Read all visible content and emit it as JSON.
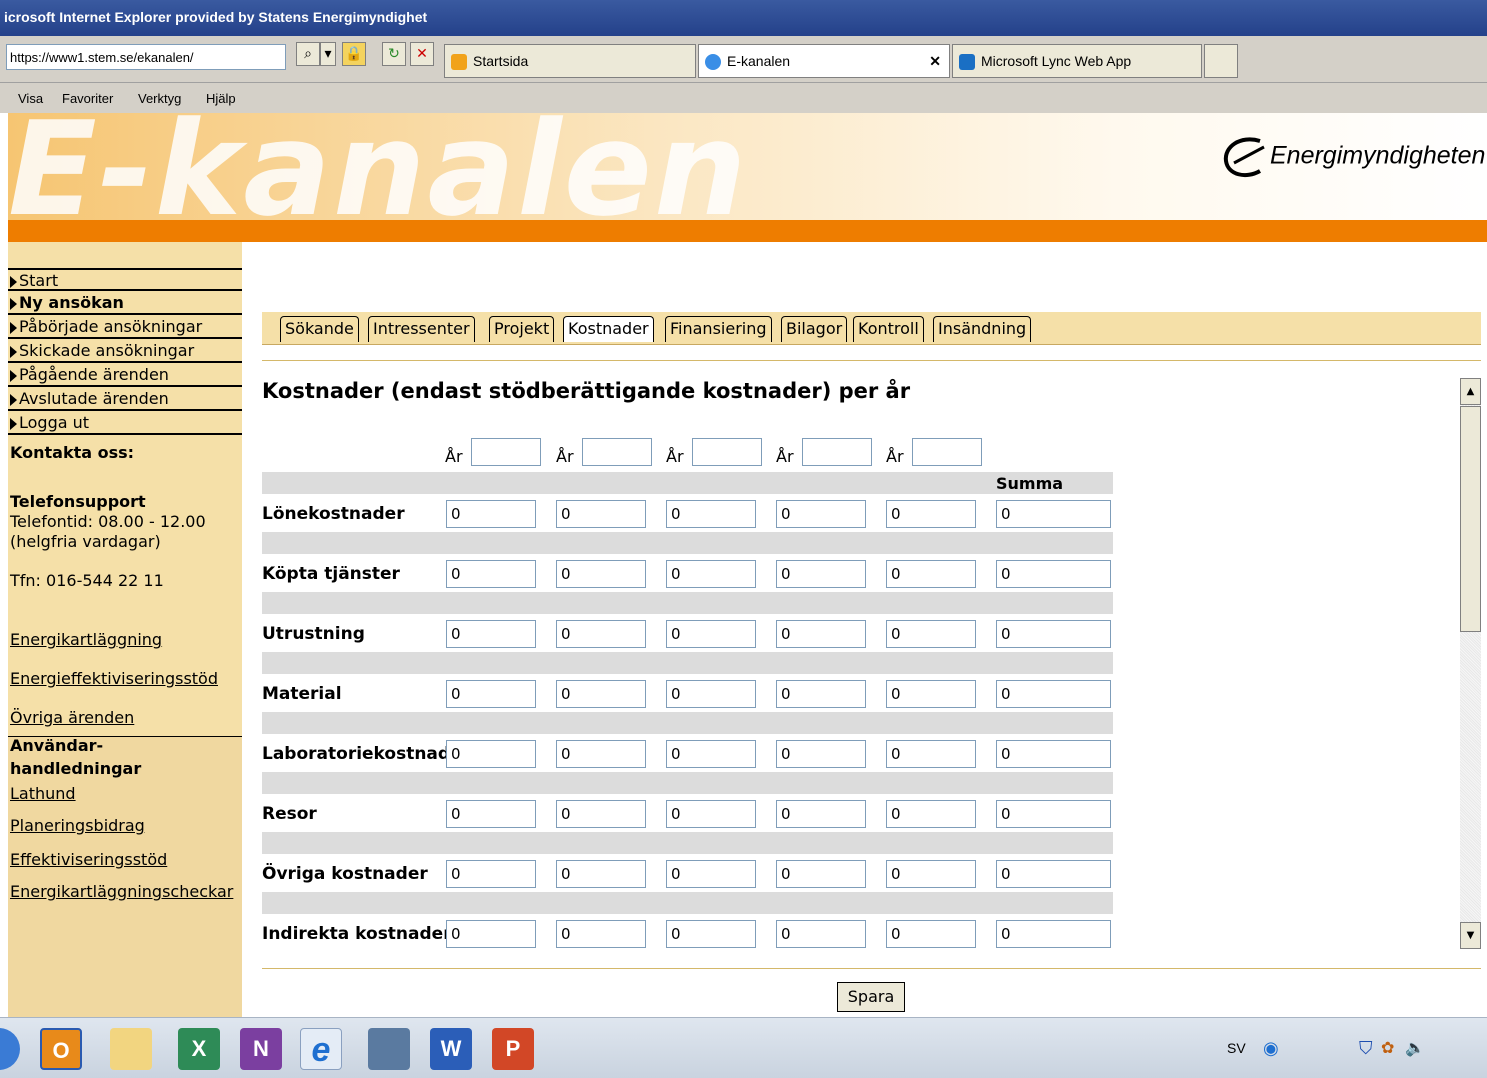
{
  "browser": {
    "title": "icrosoft Internet Explorer provided by Statens Energimyndighet",
    "address": "https://www1.stem.se/ekanalen/",
    "tabs": [
      "Startsida",
      "E-kanalen",
      "Microsoft Lync Web App"
    ],
    "menu": [
      "Visa",
      "Favoriter",
      "Verktyg",
      "Hjälp"
    ]
  },
  "banner": {
    "title": "E-kanalen",
    "logo": "Energimyndigheten"
  },
  "sidebar": {
    "nav": [
      "Start",
      "Ny ansökan",
      "Påbörjade ansökningar",
      "Skickade ansökningar",
      "Pågående ärenden",
      "Avslutade ärenden",
      "Logga ut"
    ],
    "contact_heading": "Kontakta oss:",
    "phone_heading": "Telefonsupport",
    "phone_hours_1": "Telefontid: 08.00 - 12.00",
    "phone_hours_2": "(helgfria vardagar)",
    "phone_number": "Tfn: 016-544 22 11",
    "links": [
      "Energikartläggning",
      "Energieffektiviseringsstöd",
      "Övriga ärenden"
    ],
    "guides_heading_1": "Användar-",
    "guides_heading_2": "handledningar",
    "guides": [
      "Lathund",
      "Planeringsbidrag",
      "Effektiviseringsstöd",
      "Energikartläggningscheckar"
    ]
  },
  "form": {
    "tabs": [
      "Sökande",
      "Intressenter",
      "Projekt",
      "Kostnader",
      "Finansiering",
      "Bilagor",
      "Kontroll",
      "Insändning"
    ],
    "active_tab": "Kostnader",
    "heading": "Kostnader (endast stödberättigande kostnader) per år",
    "year_label": "År",
    "sum_label": "Summa",
    "rows": [
      {
        "label": "Lönekostnader",
        "values": [
          "0",
          "0",
          "0",
          "0",
          "0",
          "0"
        ]
      },
      {
        "label": "Köpta tjänster",
        "values": [
          "0",
          "0",
          "0",
          "0",
          "0",
          "0"
        ]
      },
      {
        "label": "Utrustning",
        "values": [
          "0",
          "0",
          "0",
          "0",
          "0",
          "0"
        ]
      },
      {
        "label": "Material",
        "values": [
          "0",
          "0",
          "0",
          "0",
          "0",
          "0"
        ]
      },
      {
        "label": "Laboratoriekostnad",
        "values": [
          "0",
          "0",
          "0",
          "0",
          "0",
          "0"
        ]
      },
      {
        "label": "Resor",
        "values": [
          "0",
          "0",
          "0",
          "0",
          "0",
          "0"
        ]
      },
      {
        "label": "Övriga kostnader",
        "values": [
          "0",
          "0",
          "0",
          "0",
          "0",
          "0"
        ]
      },
      {
        "label": "Indirekta kostnader",
        "values": [
          "0",
          "0",
          "0",
          "0",
          "0",
          "0"
        ]
      }
    ],
    "save_button": "Spara"
  },
  "taskbar": {
    "apps": [
      {
        "name": "Outlook",
        "glyph": "O"
      },
      {
        "name": "Explorer",
        "glyph": ""
      },
      {
        "name": "Excel",
        "glyph": "X"
      },
      {
        "name": "OneNote",
        "glyph": "N"
      },
      {
        "name": "Internet Explorer",
        "glyph": "e"
      },
      {
        "name": "Reader",
        "glyph": ""
      },
      {
        "name": "Word",
        "glyph": "W"
      },
      {
        "name": "PowerPoint",
        "glyph": "P"
      }
    ],
    "language": "SV"
  }
}
